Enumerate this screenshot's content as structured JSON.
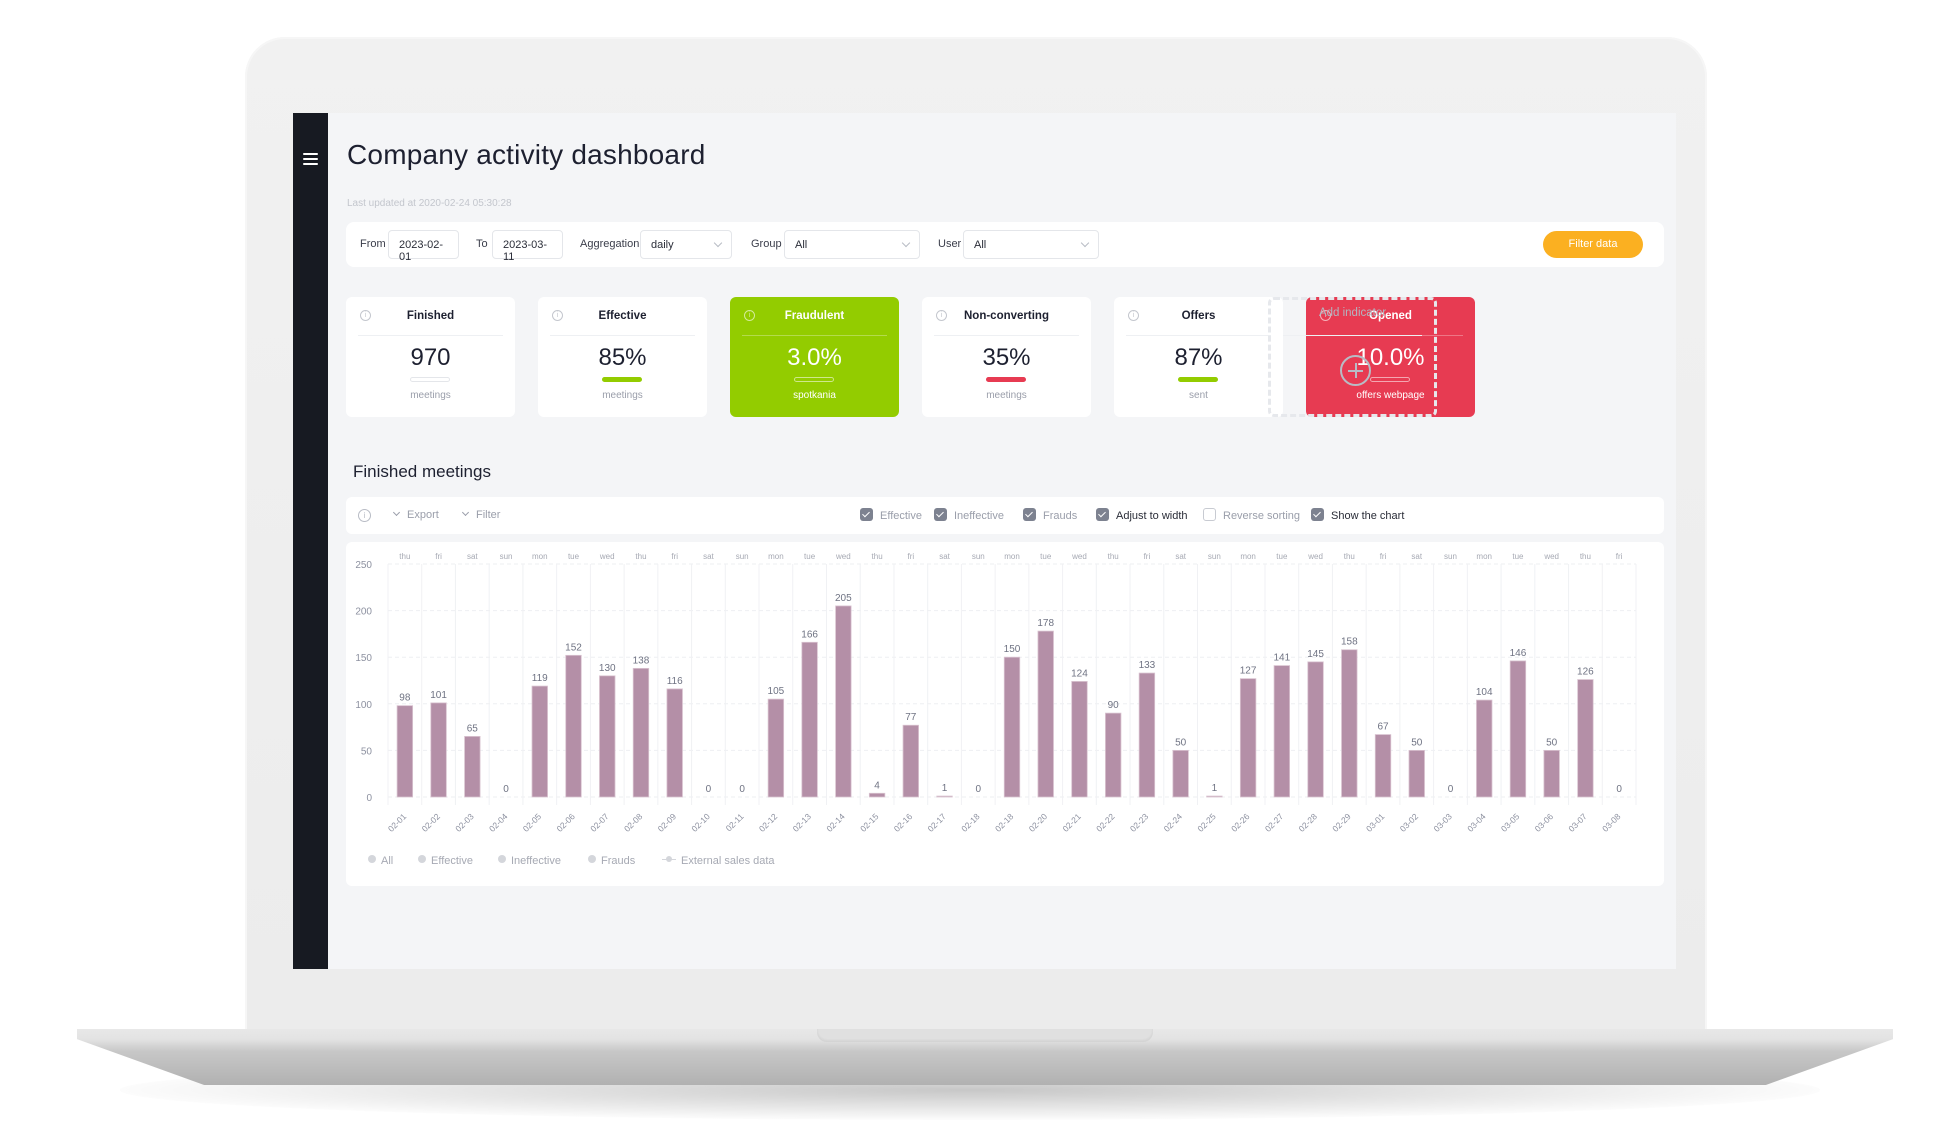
{
  "sidebar": {
    "menu_icon": "hamburger-menu-icon"
  },
  "header": {
    "title": "Company activity dashboard",
    "last_updated": "Last updated at 2020-02-24 05:30:28"
  },
  "filters": {
    "from_label": "From",
    "from_value": "2023-02-01",
    "to_label": "To",
    "to_value": "2023-03-11",
    "aggregation_label": "Aggregation",
    "aggregation_value": "daily",
    "group_label": "Group",
    "group_value": "All",
    "user_label": "User",
    "user_value": "All",
    "filter_button": "Filter data",
    "filter_button_color": "#fbb021"
  },
  "indicators": [
    {
      "name": "Finished",
      "value": "970",
      "unit": "meetings",
      "style": "white",
      "bar_color": "none"
    },
    {
      "name": "Effective",
      "value": "85%",
      "unit": "meetings",
      "style": "white",
      "bar_color": "#93cc00"
    },
    {
      "name": "Fraudulent",
      "value": "3.0%",
      "unit": "spotkania",
      "style": "green",
      "bar_color": "none"
    },
    {
      "name": "Non-converting",
      "value": "35%",
      "unit": "meetings",
      "style": "white",
      "bar_color": "#e73b52"
    },
    {
      "name": "Offers",
      "value": "87%",
      "unit": "sent",
      "style": "white",
      "bar_color": "#93cc00"
    },
    {
      "name": "Opened",
      "value": "10.0%",
      "unit": "offers webpage",
      "style": "red",
      "bar_color": "none"
    }
  ],
  "add_indicator": {
    "label": "Add indicator",
    "icon": "plus-circle-icon"
  },
  "colors": {
    "green": "#93cc00",
    "red": "#e73b52",
    "bar": "#b48fa7",
    "sidebar": "#171a22"
  },
  "section": {
    "title": "Finished meetings"
  },
  "toolbar": {
    "export_label": "Export",
    "filter_label": "Filter",
    "checkboxes": [
      {
        "label": "Effective",
        "checked": true
      },
      {
        "label": "Ineffective",
        "checked": true
      },
      {
        "label": "Frauds",
        "checked": true
      },
      {
        "label": "Adjust to width",
        "checked": true
      },
      {
        "label": "Reverse sorting",
        "checked": false
      },
      {
        "label": "Show the chart",
        "checked": true
      }
    ]
  },
  "chart_data": {
    "type": "bar",
    "title": "Finished meetings",
    "xlabel": "",
    "ylabel": "",
    "ylim": [
      0,
      250
    ],
    "yticks": [
      0,
      50,
      100,
      150,
      200,
      250
    ],
    "grid": true,
    "categories": [
      "02-01",
      "02-02",
      "02-03",
      "02-04",
      "02-05",
      "02-06",
      "02-07",
      "02-08",
      "02-09",
      "02-10",
      "02-11",
      "02-12",
      "02-13",
      "02-14",
      "02-15",
      "02-16",
      "02-17",
      "02-18",
      "02-18",
      "02-20",
      "02-21",
      "02-22",
      "02-23",
      "02-24",
      "02-25",
      "02-26",
      "02-27",
      "02-28",
      "02-29",
      "03-01",
      "03-02",
      "03-03",
      "03-04",
      "03-05",
      "03-06",
      "03-07",
      "03-08"
    ],
    "weekdays": [
      "thu",
      "fri",
      "sat",
      "sun",
      "mon",
      "tue",
      "wed",
      "thu",
      "fri",
      "sat",
      "sun",
      "mon",
      "tue",
      "wed",
      "thu",
      "fri",
      "sat",
      "sun",
      "mon",
      "tue",
      "wed",
      "thu",
      "fri",
      "sat",
      "sun",
      "mon",
      "tue",
      "wed",
      "thu",
      "fri",
      "sat",
      "sun",
      "mon",
      "tue",
      "wed",
      "thu",
      "fri"
    ],
    "values": [
      98,
      101,
      65,
      0,
      119,
      152,
      130,
      138,
      116,
      0,
      0,
      105,
      166,
      205,
      4,
      77,
      1,
      0,
      150,
      178,
      124,
      90,
      133,
      50,
      1,
      127,
      141,
      145,
      158,
      67,
      50,
      0,
      104,
      146,
      50,
      126,
      0
    ],
    "legend": [
      {
        "label": "All",
        "marker": "dot"
      },
      {
        "label": "Effective",
        "marker": "dot"
      },
      {
        "label": "Ineffective",
        "marker": "dot"
      },
      {
        "label": "Frauds",
        "marker": "dot"
      },
      {
        "label": "External sales data",
        "marker": "line-dot"
      }
    ],
    "legend_position": "bottom-left"
  }
}
